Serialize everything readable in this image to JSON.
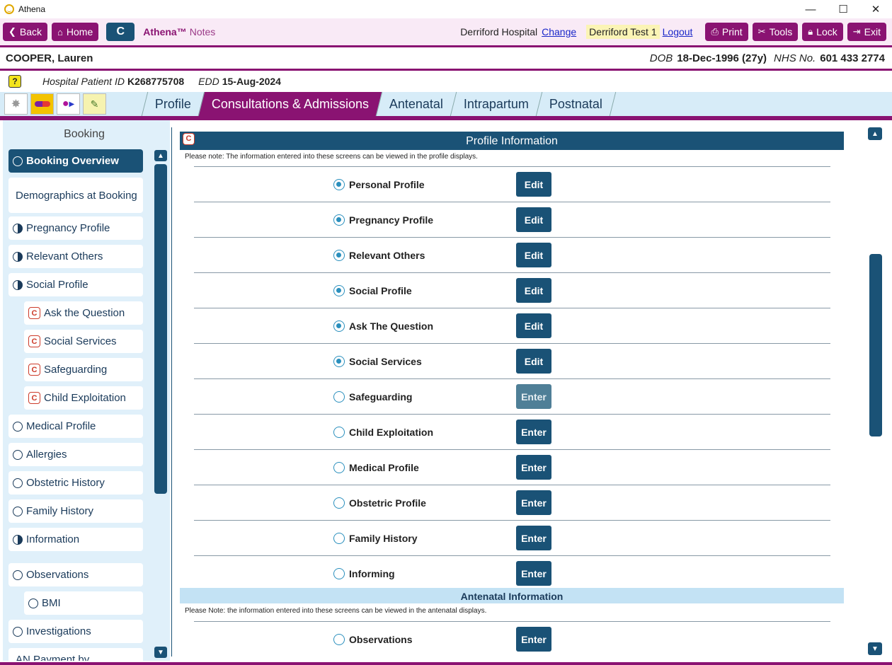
{
  "window": {
    "title": "Athena",
    "min": "—",
    "max": "☐",
    "close": "✕"
  },
  "toolbar": {
    "back": "Back",
    "home": "Home",
    "c_button": "C",
    "brand": "Athena™",
    "brand_sub": "Notes",
    "hospital": "Derriford Hospital",
    "change": "Change",
    "user": "Derriford Test 1",
    "logout": "Logout",
    "print": "Print",
    "tools": "Tools",
    "lock": "Lock",
    "exit": "Exit"
  },
  "patient": {
    "name": "COOPER, Lauren",
    "dob_label": "DOB",
    "dob": "18-Dec-1996 (27y)",
    "nhs_label": "NHS No.",
    "nhs": "601 433 2774",
    "hospital_id_label": "Hospital Patient ID",
    "hospital_id": "K268775708",
    "edd_label": "EDD",
    "edd": "15-Aug-2024",
    "help": "?"
  },
  "tabs": [
    "Profile",
    "Consultations & Admissions",
    "Antenatal",
    "Intrapartum",
    "Postnatal"
  ],
  "sidebar": {
    "title": "Booking",
    "items": [
      {
        "label": "Booking Overview",
        "status": "empty",
        "active": true
      },
      {
        "label": "Demographics at Booking",
        "status": "none"
      },
      {
        "label": "Pregnancy Profile",
        "status": "half"
      },
      {
        "label": "Relevant Others",
        "status": "half"
      },
      {
        "label": "Social Profile",
        "status": "half"
      },
      {
        "label": "Ask the Question",
        "status": "c"
      },
      {
        "label": "Social Services",
        "status": "c"
      },
      {
        "label": "Safeguarding",
        "status": "c"
      },
      {
        "label": "Child Exploitation",
        "status": "c"
      },
      {
        "label": "Medical Profile",
        "status": "empty"
      },
      {
        "label": "Allergies",
        "status": "empty"
      },
      {
        "label": "Obstetric History",
        "status": "empty"
      },
      {
        "label": "Family History",
        "status": "empty"
      },
      {
        "label": "Information",
        "status": "half"
      },
      {
        "label": "Observations",
        "status": "empty"
      },
      {
        "label": "BMI",
        "status": "empty"
      },
      {
        "label": "Investigations",
        "status": "empty"
      },
      {
        "label": "AN Payment by",
        "status": "none"
      }
    ]
  },
  "profile_section": {
    "title": "Profile Information",
    "note": "Please note: The information entered into these screens can be viewed in the profile displays.",
    "rows": [
      {
        "label": "Personal Profile",
        "done": true,
        "action": "Edit"
      },
      {
        "label": "Pregnancy Profile",
        "done": true,
        "action": "Edit"
      },
      {
        "label": "Relevant Others",
        "done": true,
        "action": "Edit"
      },
      {
        "label": "Social Profile",
        "done": true,
        "action": "Edit"
      },
      {
        "label": "Ask The Question",
        "done": true,
        "action": "Edit"
      },
      {
        "label": "Social Services",
        "done": true,
        "action": "Edit"
      },
      {
        "label": "Safeguarding",
        "done": false,
        "action": "Enter",
        "disabled": true
      },
      {
        "label": "Child Exploitation",
        "done": false,
        "action": "Enter"
      },
      {
        "label": "Medical Profile",
        "done": false,
        "action": "Enter"
      },
      {
        "label": "Obstetric Profile",
        "done": false,
        "action": "Enter"
      },
      {
        "label": "Family History",
        "done": false,
        "action": "Enter"
      },
      {
        "label": "Informing",
        "done": false,
        "action": "Enter"
      }
    ]
  },
  "antenatal_section": {
    "title": "Antenatal Information",
    "note": "Please Note: the information entered into these screens can be viewed in the antenatal displays.",
    "rows": [
      {
        "label": "Observations",
        "done": false,
        "action": "Enter"
      }
    ]
  },
  "colors": {
    "purple": "#8a1372",
    "navy": "#1a5276",
    "sidebar_bg": "#e0f0fa"
  }
}
